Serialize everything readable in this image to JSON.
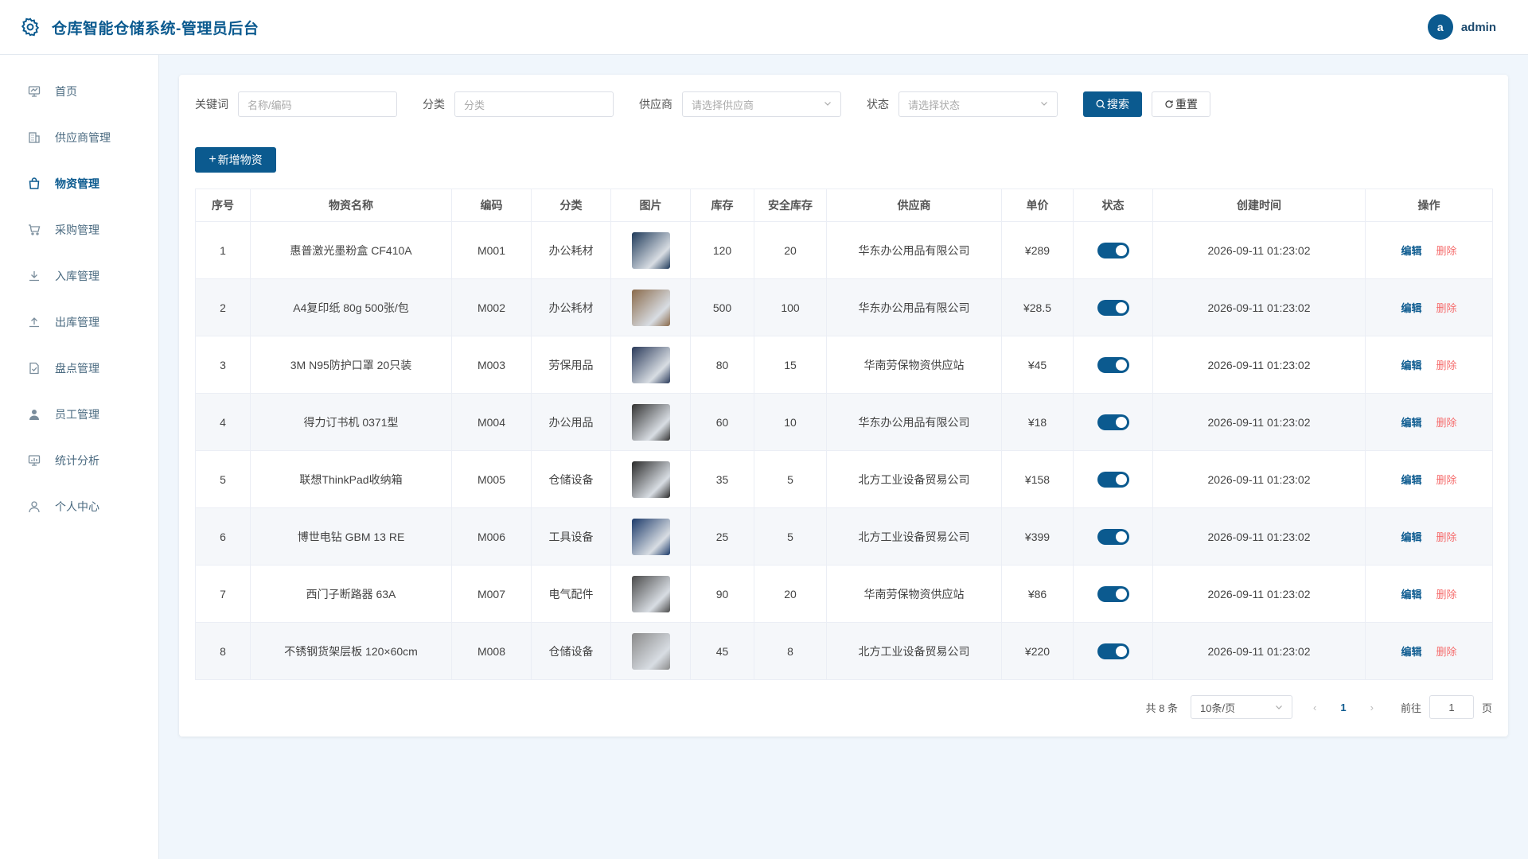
{
  "app": {
    "title": "仓库智能仓储系统-管理员后台",
    "user": {
      "avatar_letter": "a",
      "name": "admin"
    }
  },
  "sidebar": {
    "items": [
      {
        "label": "首页",
        "icon": "monitor-icon",
        "active": false
      },
      {
        "label": "供应商管理",
        "icon": "building-icon",
        "active": false
      },
      {
        "label": "物资管理",
        "icon": "bag-icon",
        "active": true
      },
      {
        "label": "采购管理",
        "icon": "cart-icon",
        "active": false
      },
      {
        "label": "入库管理",
        "icon": "download-icon",
        "active": false
      },
      {
        "label": "出库管理",
        "icon": "upload-icon",
        "active": false
      },
      {
        "label": "盘点管理",
        "icon": "checklist-icon",
        "active": false
      },
      {
        "label": "员工管理",
        "icon": "user-filled-icon",
        "active": false
      },
      {
        "label": "统计分析",
        "icon": "chart-icon",
        "active": false
      },
      {
        "label": "个人中心",
        "icon": "user-icon",
        "active": false
      }
    ]
  },
  "filters": {
    "keyword_label": "关键词",
    "keyword_placeholder": "名称/编码",
    "category_label": "分类",
    "category_placeholder": "分类",
    "supplier_label": "供应商",
    "supplier_placeholder": "请选择供应商",
    "status_label": "状态",
    "status_placeholder": "请选择状态",
    "search_label": "搜索",
    "reset_label": "重置"
  },
  "toolbar": {
    "add_label": "新增物资"
  },
  "table": {
    "columns": [
      "序号",
      "物资名称",
      "编码",
      "分类",
      "图片",
      "库存",
      "安全库存",
      "供应商",
      "单价",
      "状态",
      "创建时间",
      "操作"
    ],
    "edit_label": "编辑",
    "delete_label": "删除",
    "rows": [
      {
        "no": "1",
        "name": "惠普激光墨粉盒 CF410A",
        "code": "M001",
        "category": "办公耗材",
        "stock": "120",
        "safe": "20",
        "supplier": "华东办公用品有限公司",
        "price": "¥289",
        "status": true,
        "created": "2026-09-11 01:23:02",
        "thumb_color": "#1f3a5a"
      },
      {
        "no": "2",
        "name": "A4复印纸 80g 500张/包",
        "code": "M002",
        "category": "办公耗材",
        "stock": "500",
        "safe": "100",
        "supplier": "华东办公用品有限公司",
        "price": "¥28.5",
        "status": true,
        "created": "2026-09-11 01:23:02",
        "thumb_color": "#8a6a4a"
      },
      {
        "no": "3",
        "name": "3M N95防护口罩 20只装",
        "code": "M003",
        "category": "劳保用品",
        "stock": "80",
        "safe": "15",
        "supplier": "华南劳保物资供应站",
        "price": "¥45",
        "status": true,
        "created": "2026-09-11 01:23:02",
        "thumb_color": "#2a3a5a"
      },
      {
        "no": "4",
        "name": "得力订书机 0371型",
        "code": "M004",
        "category": "办公用品",
        "stock": "60",
        "safe": "10",
        "supplier": "华东办公用品有限公司",
        "price": "¥18",
        "status": true,
        "created": "2026-09-11 01:23:02",
        "thumb_color": "#333333"
      },
      {
        "no": "5",
        "name": "联想ThinkPad收纳箱",
        "code": "M005",
        "category": "仓储设备",
        "stock": "35",
        "safe": "5",
        "supplier": "北方工业设备贸易公司",
        "price": "¥158",
        "status": true,
        "created": "2026-09-11 01:23:02",
        "thumb_color": "#2a2a2a"
      },
      {
        "no": "6",
        "name": "博世电钻 GBM 13 RE",
        "code": "M006",
        "category": "工具设备",
        "stock": "25",
        "safe": "5",
        "supplier": "北方工业设备贸易公司",
        "price": "¥399",
        "status": true,
        "created": "2026-09-11 01:23:02",
        "thumb_color": "#1c3a6a"
      },
      {
        "no": "7",
        "name": "西门子断路器 63A",
        "code": "M007",
        "category": "电气配件",
        "stock": "90",
        "safe": "20",
        "supplier": "华南劳保物资供应站",
        "price": "¥86",
        "status": true,
        "created": "2026-09-11 01:23:02",
        "thumb_color": "#4a4a4a"
      },
      {
        "no": "8",
        "name": "不锈钢货架层板 120×60cm",
        "code": "M008",
        "category": "仓储设备",
        "stock": "45",
        "safe": "8",
        "supplier": "北方工业设备贸易公司",
        "price": "¥220",
        "status": true,
        "created": "2026-09-11 01:23:02",
        "thumb_color": "#8a8a8a"
      }
    ]
  },
  "pagination": {
    "total_label": "共 8 条",
    "page_size": "10条/页",
    "current_page": "1",
    "goto_label": "前往",
    "goto_value": "1",
    "page_suffix": "页"
  }
}
